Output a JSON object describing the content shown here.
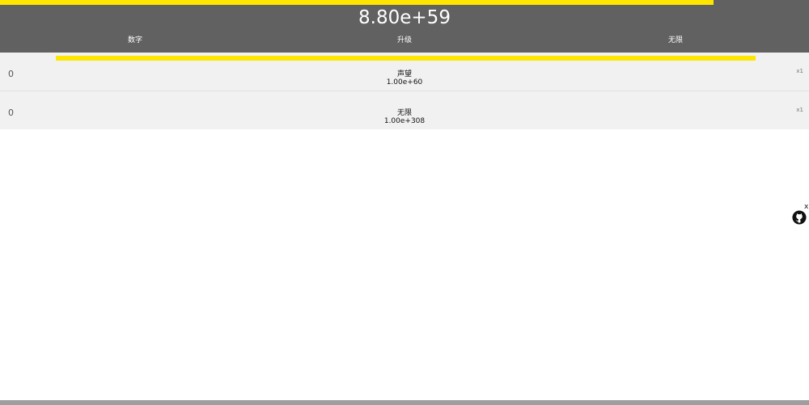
{
  "header": {
    "main_number": "8.80e+59",
    "top_progress_percent": 88.2,
    "tabs": [
      {
        "label": "数字"
      },
      {
        "label": "升级"
      },
      {
        "label": "无限"
      }
    ]
  },
  "section_progress_percent": 100,
  "rows": [
    {
      "count": "0",
      "title": "声望",
      "cost": "1.00e+60",
      "multiplier": "x1"
    },
    {
      "count": "0",
      "title": "无限",
      "cost": "1.00e+308",
      "multiplier": "x1"
    }
  ],
  "widget": {
    "close_label": "x",
    "icon": "github-icon"
  },
  "colors": {
    "header_bg": "#616161",
    "accent": "#ffe600",
    "row_bg": "#f1f1f1",
    "bottom_bar": "#9e9e9e"
  }
}
